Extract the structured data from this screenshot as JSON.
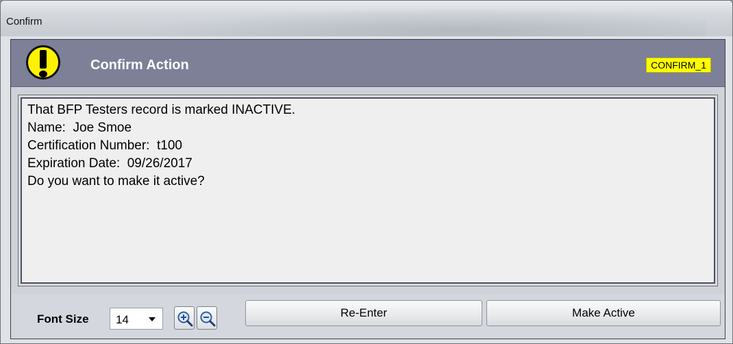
{
  "window": {
    "title": "Confirm"
  },
  "header": {
    "title": "Confirm Action",
    "dialog_id": "CONFIRM_1",
    "icon": "exclamation-warning-icon"
  },
  "message": {
    "lines": [
      "That BFP Testers record is marked INACTIVE.",
      "Name:  Joe Smoe",
      "Certification Number:  t100",
      "Expiration Date:  09/26/2017",
      "Do you want to make it active?"
    ]
  },
  "footer": {
    "font_size_label": "Font Size",
    "font_size_value": "14",
    "zoom_in_icon": "zoom-in-icon",
    "zoom_out_icon": "zoom-out-icon",
    "reenter_label": "Re-Enter",
    "make_active_label": "Make Active"
  },
  "colors": {
    "header_bg": "#7e8098",
    "id_badge_bg": "#ffff00",
    "warning_icon": "#fff200"
  }
}
